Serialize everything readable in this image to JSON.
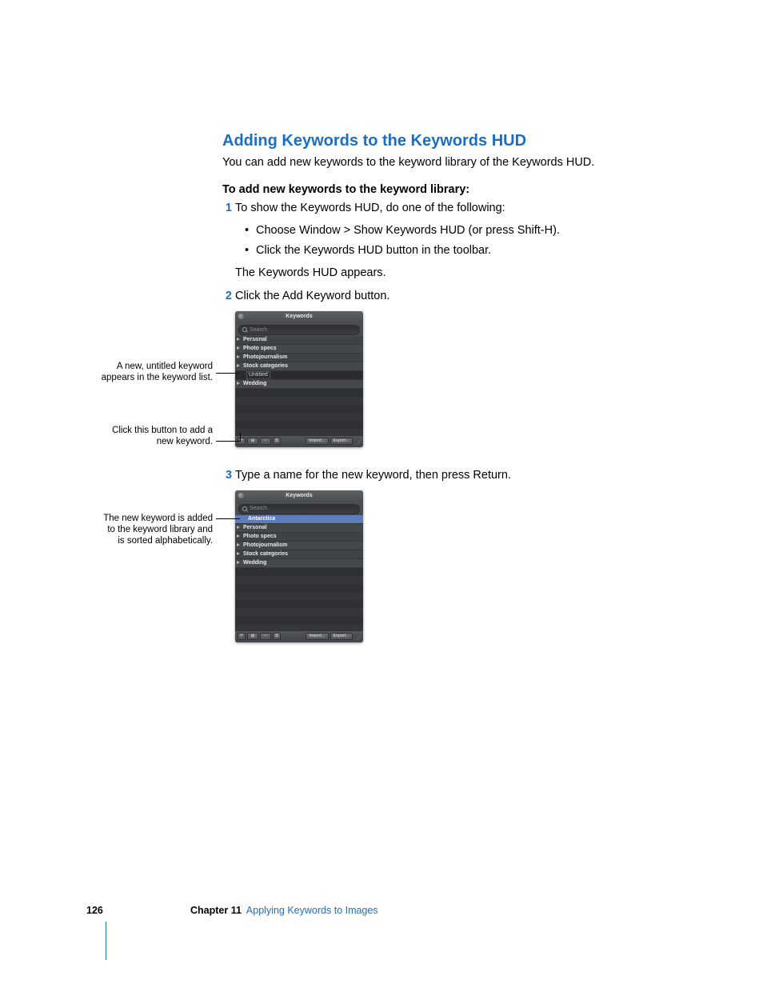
{
  "heading": "Adding Keywords to the Keywords HUD",
  "intro": "You can add new keywords to the keyword library of the Keywords HUD.",
  "procedure_title": "To add new keywords to the keyword library:",
  "step1": {
    "text": "To show the Keywords HUD, do one of the following:",
    "bullet_a": "Choose Window > Show Keywords HUD (or press Shift-H).",
    "bullet_b": "Click the Keywords HUD button in the toolbar.",
    "result": "The Keywords HUD appears."
  },
  "step2": "Click the Add Keyword button.",
  "step3": "Type a name for the new keyword, then press Return.",
  "callouts": {
    "c1": "A new, untitled keyword appears in the keyword list.",
    "c2": "Click this button to add a new keyword.",
    "c3": "The new keyword is added to the keyword library and is sorted alphabetically."
  },
  "hud1": {
    "title": "Keywords",
    "search_placeholder": "Search",
    "items": [
      "Personal",
      "Photo specs",
      "Photojournalism",
      "Stock categories"
    ],
    "editing_item": "Untitled",
    "after_editing": [
      "Wedding"
    ],
    "buttons": {
      "import": "Import...",
      "export": "Export..."
    }
  },
  "hud2": {
    "title": "Keywords",
    "search_placeholder": "Search",
    "selected_item": "Antarctica",
    "items_after": [
      "Personal",
      "Photo specs",
      "Photojournalism",
      "Stock categories",
      "Wedding"
    ],
    "buttons": {
      "import": "Import...",
      "export": "Export..."
    }
  },
  "footer": {
    "page": "126",
    "chapter_label": "Chapter 11",
    "chapter_title": "Applying Keywords to Images"
  }
}
